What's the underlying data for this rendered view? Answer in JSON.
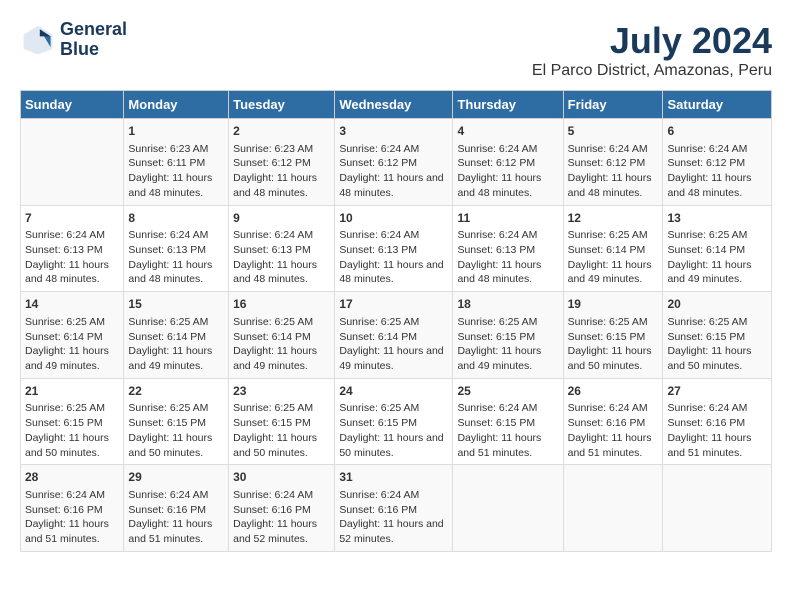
{
  "logo": {
    "line1": "General",
    "line2": "Blue"
  },
  "title": "July 2024",
  "subtitle": "El Parco District, Amazonas, Peru",
  "days_of_week": [
    "Sunday",
    "Monday",
    "Tuesday",
    "Wednesday",
    "Thursday",
    "Friday",
    "Saturday"
  ],
  "weeks": [
    [
      {
        "day": "",
        "sunrise": "",
        "sunset": "",
        "daylight": ""
      },
      {
        "day": "1",
        "sunrise": "Sunrise: 6:23 AM",
        "sunset": "Sunset: 6:11 PM",
        "daylight": "Daylight: 11 hours and 48 minutes."
      },
      {
        "day": "2",
        "sunrise": "Sunrise: 6:23 AM",
        "sunset": "Sunset: 6:12 PM",
        "daylight": "Daylight: 11 hours and 48 minutes."
      },
      {
        "day": "3",
        "sunrise": "Sunrise: 6:24 AM",
        "sunset": "Sunset: 6:12 PM",
        "daylight": "Daylight: 11 hours and 48 minutes."
      },
      {
        "day": "4",
        "sunrise": "Sunrise: 6:24 AM",
        "sunset": "Sunset: 6:12 PM",
        "daylight": "Daylight: 11 hours and 48 minutes."
      },
      {
        "day": "5",
        "sunrise": "Sunrise: 6:24 AM",
        "sunset": "Sunset: 6:12 PM",
        "daylight": "Daylight: 11 hours and 48 minutes."
      },
      {
        "day": "6",
        "sunrise": "Sunrise: 6:24 AM",
        "sunset": "Sunset: 6:12 PM",
        "daylight": "Daylight: 11 hours and 48 minutes."
      }
    ],
    [
      {
        "day": "7",
        "sunrise": "Sunrise: 6:24 AM",
        "sunset": "Sunset: 6:13 PM",
        "daylight": "Daylight: 11 hours and 48 minutes."
      },
      {
        "day": "8",
        "sunrise": "Sunrise: 6:24 AM",
        "sunset": "Sunset: 6:13 PM",
        "daylight": "Daylight: 11 hours and 48 minutes."
      },
      {
        "day": "9",
        "sunrise": "Sunrise: 6:24 AM",
        "sunset": "Sunset: 6:13 PM",
        "daylight": "Daylight: 11 hours and 48 minutes."
      },
      {
        "day": "10",
        "sunrise": "Sunrise: 6:24 AM",
        "sunset": "Sunset: 6:13 PM",
        "daylight": "Daylight: 11 hours and 48 minutes."
      },
      {
        "day": "11",
        "sunrise": "Sunrise: 6:24 AM",
        "sunset": "Sunset: 6:13 PM",
        "daylight": "Daylight: 11 hours and 48 minutes."
      },
      {
        "day": "12",
        "sunrise": "Sunrise: 6:25 AM",
        "sunset": "Sunset: 6:14 PM",
        "daylight": "Daylight: 11 hours and 49 minutes."
      },
      {
        "day": "13",
        "sunrise": "Sunrise: 6:25 AM",
        "sunset": "Sunset: 6:14 PM",
        "daylight": "Daylight: 11 hours and 49 minutes."
      }
    ],
    [
      {
        "day": "14",
        "sunrise": "Sunrise: 6:25 AM",
        "sunset": "Sunset: 6:14 PM",
        "daylight": "Daylight: 11 hours and 49 minutes."
      },
      {
        "day": "15",
        "sunrise": "Sunrise: 6:25 AM",
        "sunset": "Sunset: 6:14 PM",
        "daylight": "Daylight: 11 hours and 49 minutes."
      },
      {
        "day": "16",
        "sunrise": "Sunrise: 6:25 AM",
        "sunset": "Sunset: 6:14 PM",
        "daylight": "Daylight: 11 hours and 49 minutes."
      },
      {
        "day": "17",
        "sunrise": "Sunrise: 6:25 AM",
        "sunset": "Sunset: 6:14 PM",
        "daylight": "Daylight: 11 hours and 49 minutes."
      },
      {
        "day": "18",
        "sunrise": "Sunrise: 6:25 AM",
        "sunset": "Sunset: 6:15 PM",
        "daylight": "Daylight: 11 hours and 49 minutes."
      },
      {
        "day": "19",
        "sunrise": "Sunrise: 6:25 AM",
        "sunset": "Sunset: 6:15 PM",
        "daylight": "Daylight: 11 hours and 50 minutes."
      },
      {
        "day": "20",
        "sunrise": "Sunrise: 6:25 AM",
        "sunset": "Sunset: 6:15 PM",
        "daylight": "Daylight: 11 hours and 50 minutes."
      }
    ],
    [
      {
        "day": "21",
        "sunrise": "Sunrise: 6:25 AM",
        "sunset": "Sunset: 6:15 PM",
        "daylight": "Daylight: 11 hours and 50 minutes."
      },
      {
        "day": "22",
        "sunrise": "Sunrise: 6:25 AM",
        "sunset": "Sunset: 6:15 PM",
        "daylight": "Daylight: 11 hours and 50 minutes."
      },
      {
        "day": "23",
        "sunrise": "Sunrise: 6:25 AM",
        "sunset": "Sunset: 6:15 PM",
        "daylight": "Daylight: 11 hours and 50 minutes."
      },
      {
        "day": "24",
        "sunrise": "Sunrise: 6:25 AM",
        "sunset": "Sunset: 6:15 PM",
        "daylight": "Daylight: 11 hours and 50 minutes."
      },
      {
        "day": "25",
        "sunrise": "Sunrise: 6:24 AM",
        "sunset": "Sunset: 6:15 PM",
        "daylight": "Daylight: 11 hours and 51 minutes."
      },
      {
        "day": "26",
        "sunrise": "Sunrise: 6:24 AM",
        "sunset": "Sunset: 6:16 PM",
        "daylight": "Daylight: 11 hours and 51 minutes."
      },
      {
        "day": "27",
        "sunrise": "Sunrise: 6:24 AM",
        "sunset": "Sunset: 6:16 PM",
        "daylight": "Daylight: 11 hours and 51 minutes."
      }
    ],
    [
      {
        "day": "28",
        "sunrise": "Sunrise: 6:24 AM",
        "sunset": "Sunset: 6:16 PM",
        "daylight": "Daylight: 11 hours and 51 minutes."
      },
      {
        "day": "29",
        "sunrise": "Sunrise: 6:24 AM",
        "sunset": "Sunset: 6:16 PM",
        "daylight": "Daylight: 11 hours and 51 minutes."
      },
      {
        "day": "30",
        "sunrise": "Sunrise: 6:24 AM",
        "sunset": "Sunset: 6:16 PM",
        "daylight": "Daylight: 11 hours and 52 minutes."
      },
      {
        "day": "31",
        "sunrise": "Sunrise: 6:24 AM",
        "sunset": "Sunset: 6:16 PM",
        "daylight": "Daylight: 11 hours and 52 minutes."
      },
      {
        "day": "",
        "sunrise": "",
        "sunset": "",
        "daylight": ""
      },
      {
        "day": "",
        "sunrise": "",
        "sunset": "",
        "daylight": ""
      },
      {
        "day": "",
        "sunrise": "",
        "sunset": "",
        "daylight": ""
      }
    ]
  ]
}
